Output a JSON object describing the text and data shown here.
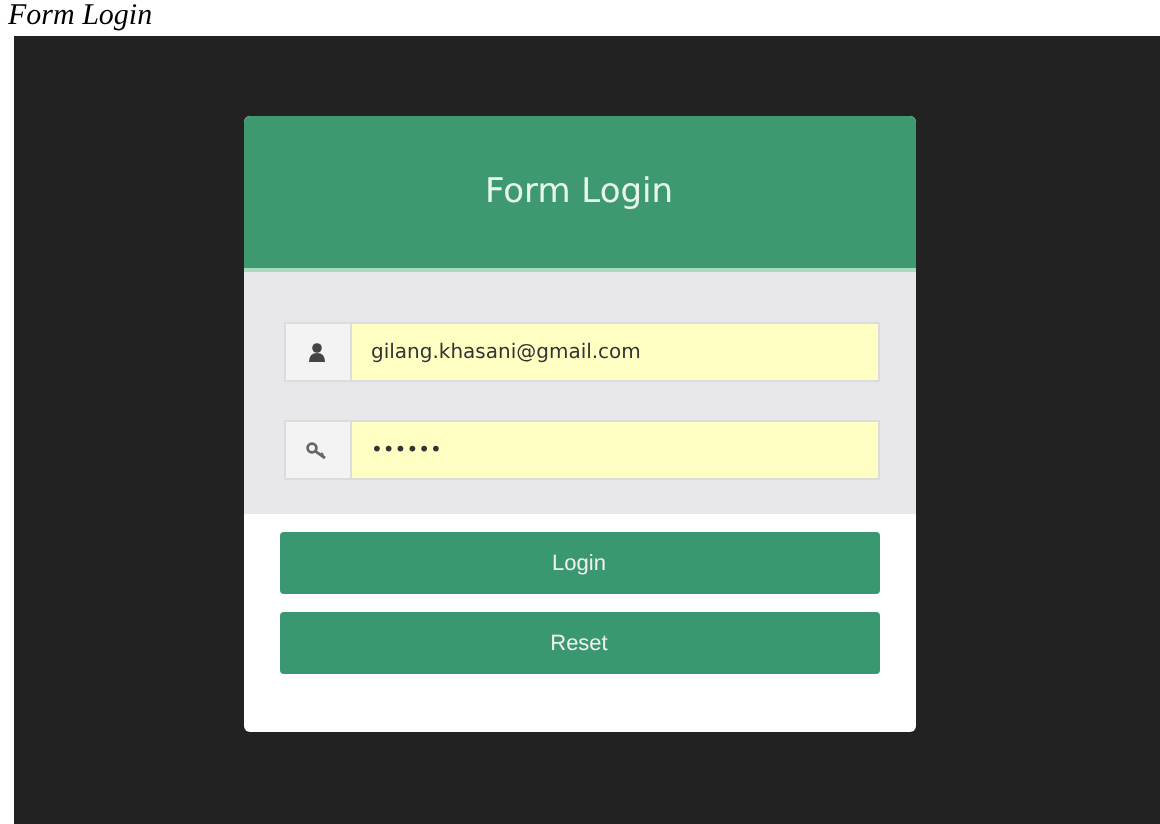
{
  "caption": "Form Login",
  "card": {
    "title": "Form Login",
    "fields": [
      {
        "kind": "user",
        "value": "gilang.khasani@gmail.com"
      },
      {
        "kind": "key",
        "value": "••••••"
      }
    ],
    "buttons": [
      "Login",
      "Reset"
    ]
  }
}
